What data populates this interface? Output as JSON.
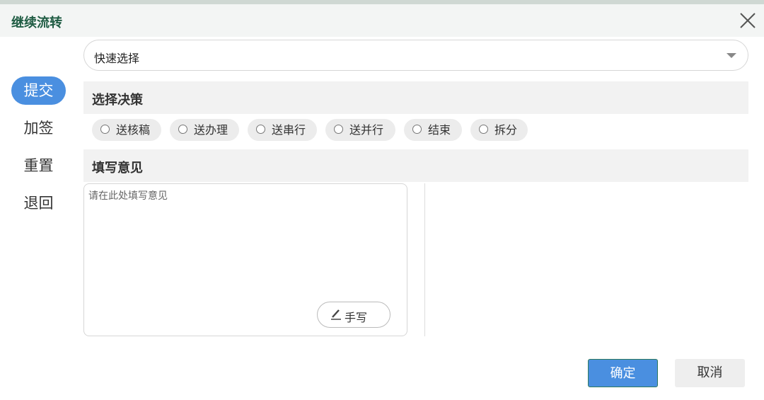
{
  "window": {
    "title": "继续流转",
    "close_icon": "close-icon"
  },
  "quick_select": {
    "selected": "快速选择",
    "caret_icon": "caret-down-icon"
  },
  "side_nav": {
    "items": [
      {
        "label": "提交",
        "active": true
      },
      {
        "label": "加签",
        "active": false
      },
      {
        "label": "重置",
        "active": false
      },
      {
        "label": "退回",
        "active": false
      }
    ]
  },
  "decision": {
    "heading": "选择决策",
    "options": [
      "送核稿",
      "送办理",
      "送串行",
      "送并行",
      "结束",
      "拆分"
    ],
    "selected": null
  },
  "opinion": {
    "heading": "填写意见",
    "placeholder": "请在此处填写意见",
    "value": "",
    "handwrite_label": "手写",
    "handwrite_icon": "pen-icon"
  },
  "footer": {
    "confirm_label": "确定",
    "cancel_label": "取消"
  },
  "colors": {
    "accent": "#4a8fe0",
    "title": "#1f5c43",
    "section_bg": "#f2f2f2",
    "pill_bg": "#ececec"
  }
}
